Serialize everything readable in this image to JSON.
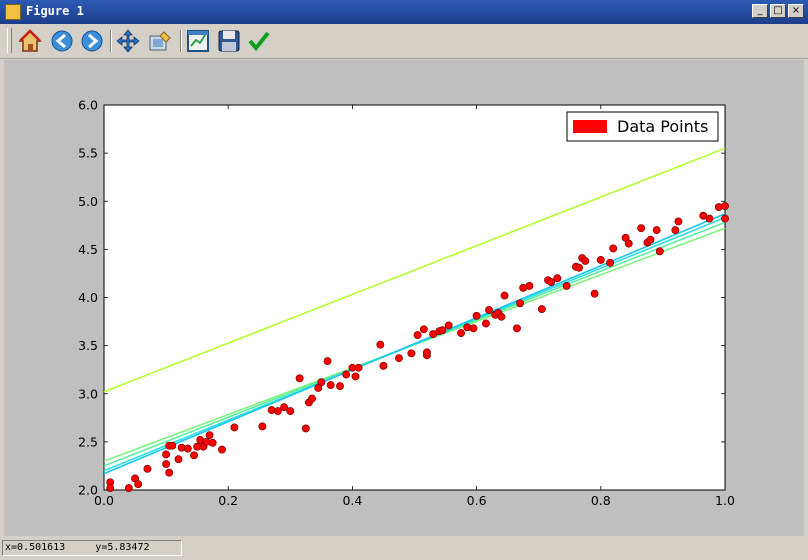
{
  "window": {
    "title": "Figure 1",
    "buttons": {
      "minimize": "_",
      "maximize": "□",
      "close": "×"
    }
  },
  "toolbar": {
    "tools": [
      {
        "name": "home-button",
        "icon": "home-icon"
      },
      {
        "name": "back-button",
        "icon": "arrow-left-icon"
      },
      {
        "name": "forward-button",
        "icon": "arrow-right-icon"
      },
      {
        "name": "pan-button",
        "icon": "move-icon"
      },
      {
        "name": "zoom-button",
        "icon": "zoom-rect-icon"
      },
      {
        "name": "subplots-button",
        "icon": "subplots-icon"
      },
      {
        "name": "save-button",
        "icon": "floppy-icon"
      },
      {
        "name": "edit-button",
        "icon": "checkmark-icon"
      }
    ]
  },
  "status": {
    "text": "x=0.501613     y=5.83472"
  },
  "chart_data": {
    "type": "scatter",
    "xlim": [
      0.0,
      1.0
    ],
    "ylim": [
      2.0,
      6.0
    ],
    "x_ticks": [
      "0.0",
      "0.2",
      "0.4",
      "0.6",
      "0.8",
      "1.0"
    ],
    "y_ticks": [
      "2.0",
      "2.5",
      "3.0",
      "3.5",
      "4.0",
      "4.5",
      "5.0",
      "5.5",
      "6.0"
    ],
    "grid": false,
    "legend": {
      "position": "top-right",
      "entries": [
        {
          "label": "Data Points",
          "color": "#ff0000"
        }
      ]
    },
    "points": {
      "color": "#ff0000",
      "edge_color": "#7a0000",
      "x": [
        0.01,
        0.01,
        0.04,
        0.05,
        0.055,
        0.07,
        0.1,
        0.1,
        0.105,
        0.105,
        0.11,
        0.12,
        0.125,
        0.135,
        0.145,
        0.15,
        0.155,
        0.16,
        0.165,
        0.17,
        0.175,
        0.19,
        0.21,
        0.255,
        0.27,
        0.28,
        0.29,
        0.3,
        0.315,
        0.325,
        0.33,
        0.335,
        0.345,
        0.35,
        0.36,
        0.365,
        0.38,
        0.39,
        0.4,
        0.405,
        0.41,
        0.445,
        0.45,
        0.475,
        0.495,
        0.505,
        0.515,
        0.52,
        0.52,
        0.53,
        0.54,
        0.545,
        0.555,
        0.575,
        0.585,
        0.595,
        0.6,
        0.615,
        0.62,
        0.63,
        0.635,
        0.64,
        0.645,
        0.665,
        0.67,
        0.675,
        0.685,
        0.705,
        0.715,
        0.72,
        0.73,
        0.745,
        0.76,
        0.765,
        0.77,
        0.775,
        0.79,
        0.8,
        0.815,
        0.82,
        0.84,
        0.845,
        0.865,
        0.875,
        0.88,
        0.89,
        0.895,
        0.92,
        0.925,
        0.965,
        0.975,
        0.99,
        1.0,
        1.0
      ],
      "y": [
        2.08,
        2.02,
        2.02,
        2.12,
        2.06,
        2.22,
        2.27,
        2.37,
        2.18,
        2.46,
        2.46,
        2.32,
        2.44,
        2.43,
        2.36,
        2.45,
        2.52,
        2.45,
        2.5,
        2.57,
        2.49,
        2.42,
        2.65,
        2.66,
        2.83,
        2.82,
        2.86,
        2.82,
        3.16,
        2.64,
        2.91,
        2.95,
        3.06,
        3.12,
        3.34,
        3.09,
        3.08,
        3.2,
        3.27,
        3.18,
        3.27,
        3.51,
        3.29,
        3.37,
        3.42,
        3.61,
        3.67,
        3.4,
        3.43,
        3.62,
        3.65,
        3.66,
        3.71,
        3.63,
        3.69,
        3.68,
        3.81,
        3.73,
        3.87,
        3.82,
        3.84,
        3.8,
        4.02,
        3.68,
        3.94,
        4.1,
        4.12,
        3.88,
        4.18,
        4.16,
        4.2,
        4.12,
        4.32,
        4.31,
        4.41,
        4.38,
        4.04,
        4.39,
        4.36,
        4.51,
        4.62,
        4.56,
        4.72,
        4.57,
        4.6,
        4.7,
        4.48,
        4.7,
        4.79,
        4.85,
        4.82,
        4.94,
        4.95,
        4.82
      ]
    },
    "lines": [
      {
        "color": "#b3ff2e",
        "y0": 3.02,
        "y1": 5.55
      },
      {
        "color": "#7ff27f",
        "y0": 2.3,
        "y1": 4.72
      },
      {
        "color": "#5cf0a0",
        "y0": 2.25,
        "y1": 4.78
      },
      {
        "color": "#2fdfdf",
        "y0": 2.2,
        "y1": 4.83
      },
      {
        "color": "#18c8f0",
        "y0": 2.17,
        "y1": 4.87
      }
    ]
  }
}
